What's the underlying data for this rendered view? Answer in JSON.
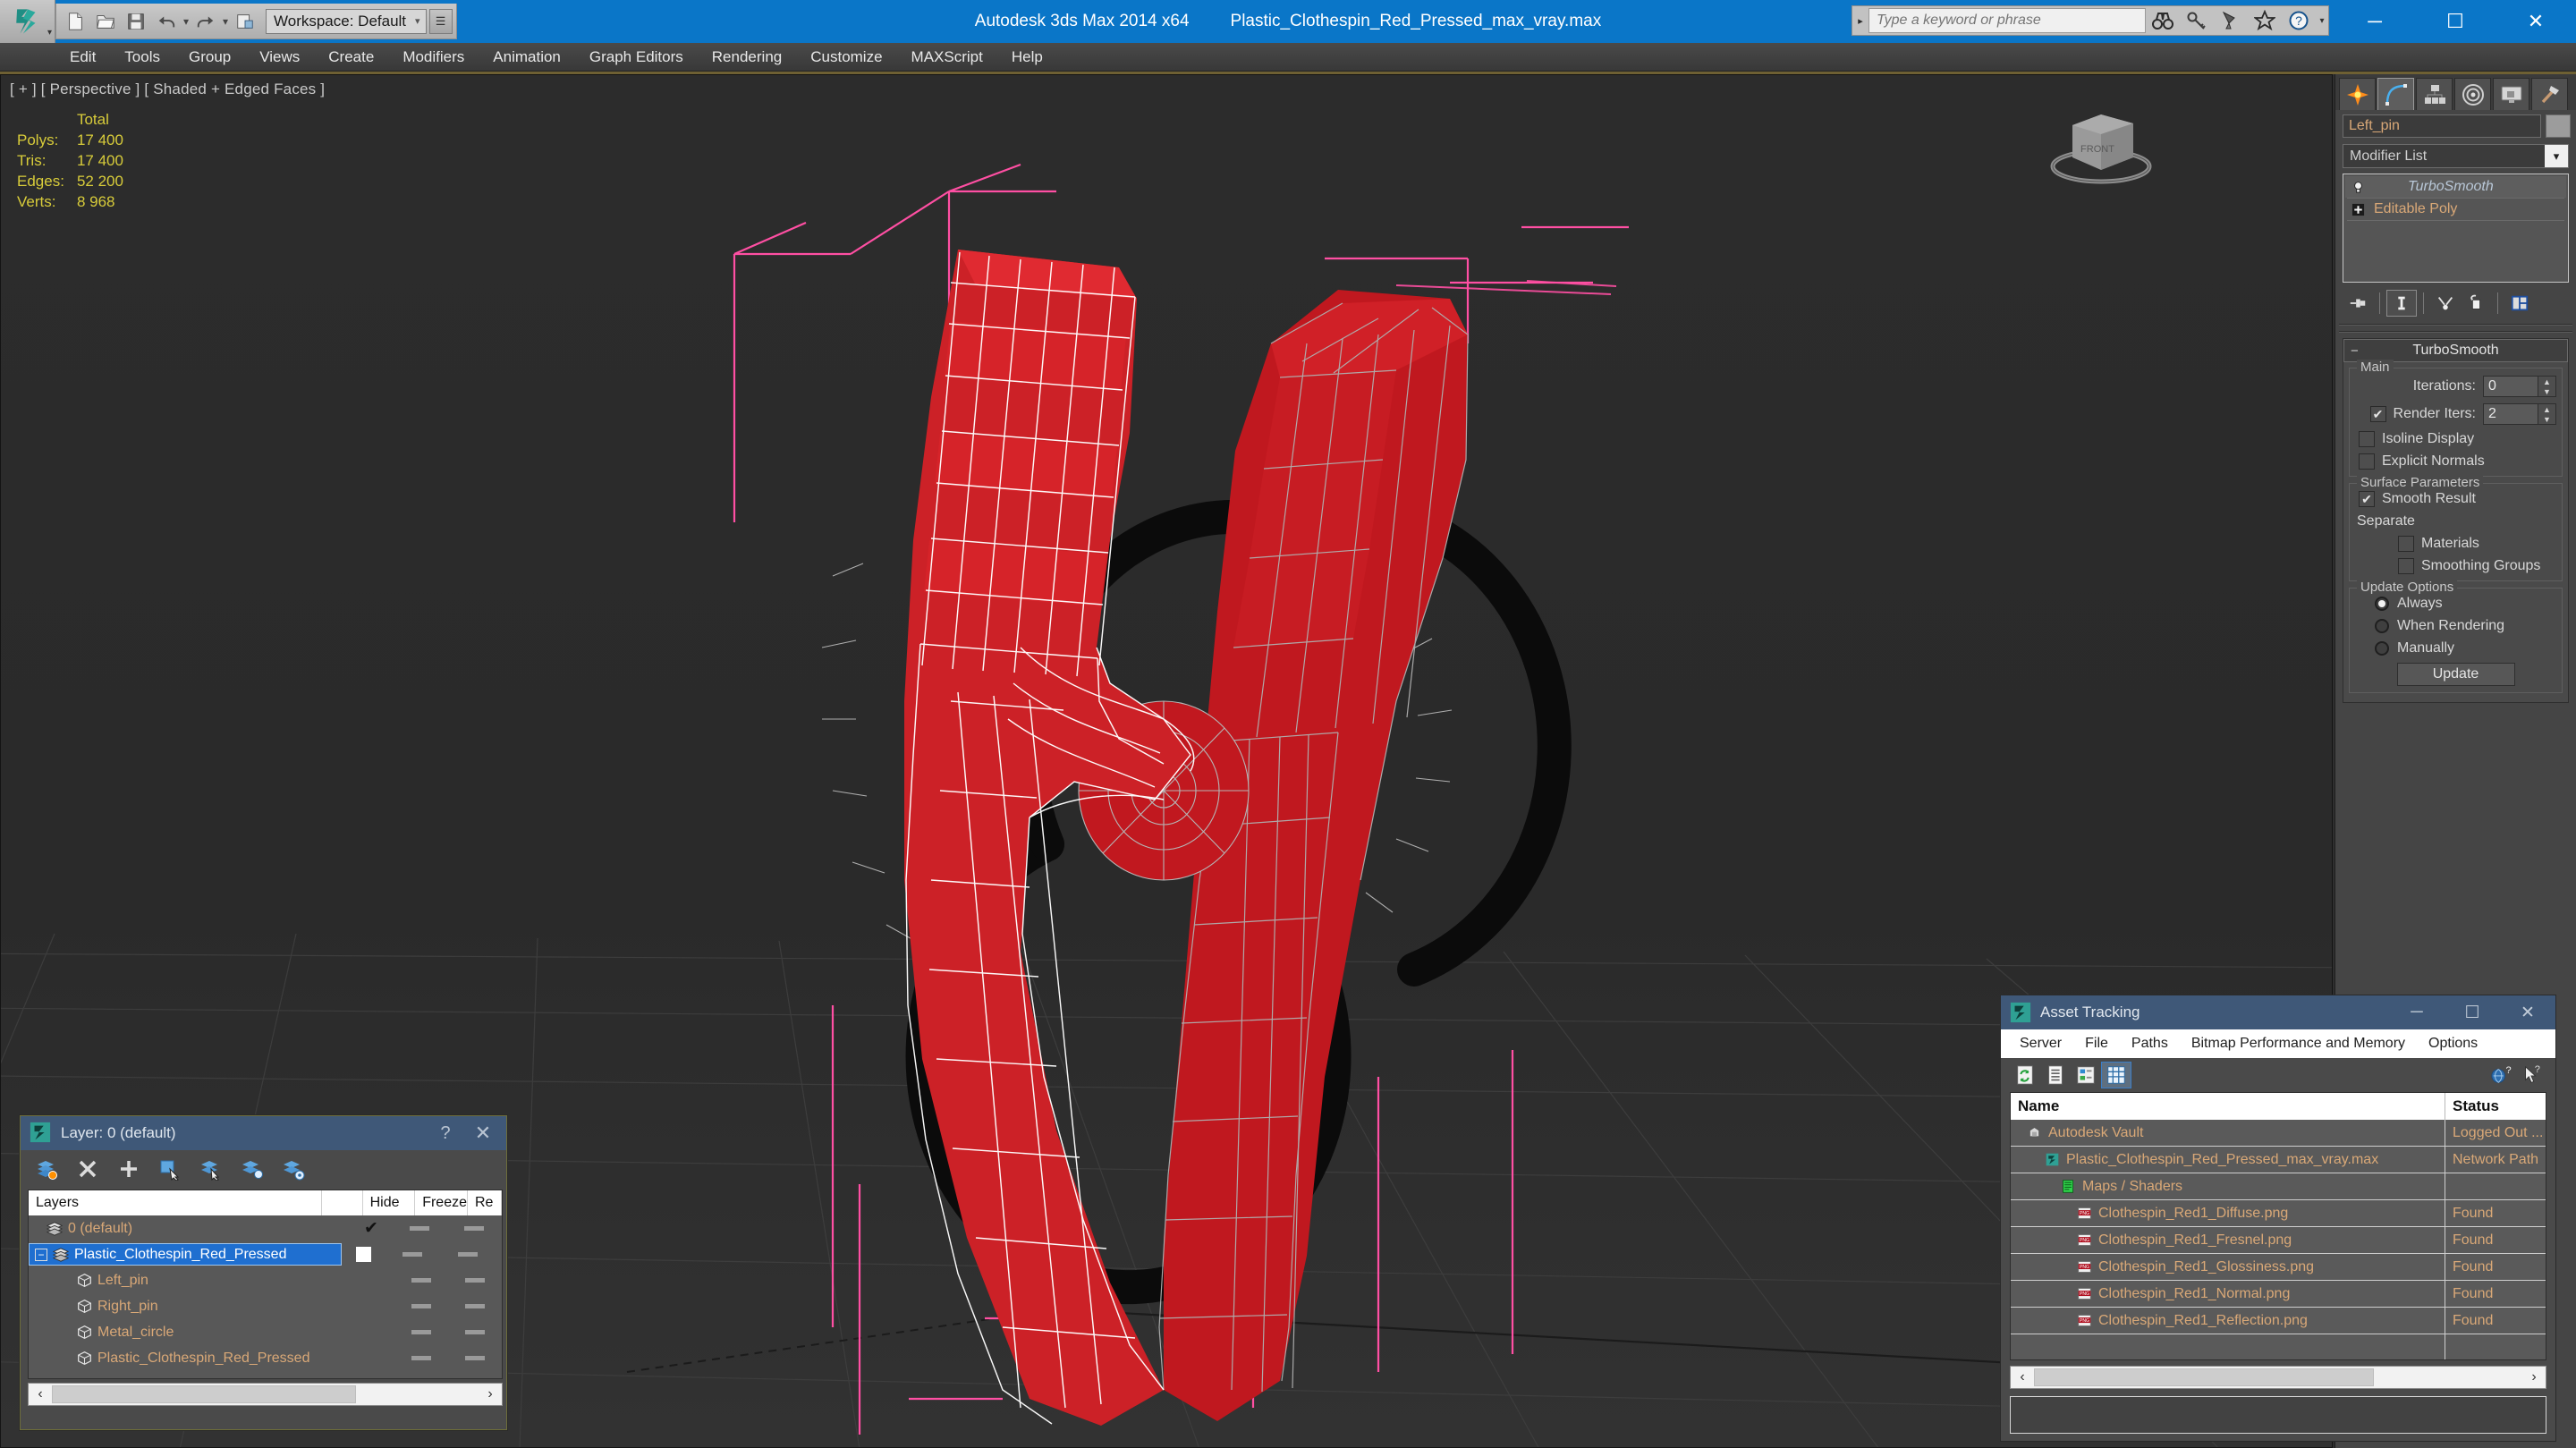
{
  "titlebar": {
    "workspace_label": "Workspace: Default",
    "app_title": "Autodesk 3ds Max  2014 x64",
    "file_title": "Plastic_Clothespin_Red_Pressed_max_vray.max",
    "search_placeholder": "Type a keyword or phrase",
    "minimize": "─",
    "maximize": "☐",
    "close": "✕",
    "quick_access": [
      "new-icon",
      "open-icon",
      "save-icon",
      "undo-icon",
      "redo-icon",
      "set-project-icon"
    ],
    "search_icons": [
      "binoculars-icon",
      "key-icon",
      "satellite-icon",
      "star-icon",
      "help-icon"
    ]
  },
  "menu": {
    "items": [
      "Edit",
      "Tools",
      "Group",
      "Views",
      "Create",
      "Modifiers",
      "Animation",
      "Graph Editors",
      "Rendering",
      "Customize",
      "MAXScript",
      "Help"
    ]
  },
  "viewport": {
    "label": "[ + ] [ Perspective ] [ Shaded + Edged Faces ]",
    "stats": {
      "header": "Total",
      "rows": [
        {
          "label": "Polys:",
          "value": "17 400"
        },
        {
          "label": "Tris:",
          "value": "17 400"
        },
        {
          "label": "Edges:",
          "value": "52 200"
        },
        {
          "label": "Verts:",
          "value": "8 968"
        }
      ]
    },
    "viewcube_face": "FRONT",
    "bg_color": "#2b2b2b",
    "model_color": "#cc2127",
    "selected_wire_color": "#ffffff",
    "unselected_wire_color": "#b4b4b4",
    "gizmo_color": "#ff49a0"
  },
  "command_panel": {
    "tabs": [
      "create-tab-icon",
      "modify-tab-icon",
      "hierarchy-tab-icon",
      "motion-tab-icon",
      "display-tab-icon",
      "utilities-tab-icon"
    ],
    "active_tab_index": 1,
    "object_name": "Left_pin",
    "modifier_list_label": "Modifier List",
    "stack": [
      {
        "name": "TurboSmooth",
        "italic": true,
        "selected": true,
        "icon": "light-bulb-icon"
      },
      {
        "name": "Editable Poly",
        "italic": false,
        "selected": false,
        "icon": "plus-box-icon"
      }
    ],
    "stack_tools": [
      "pin-stack-icon",
      "show-end-result-icon",
      "make-unique-icon",
      "remove-modifier-icon",
      "configure-modifier-sets-icon"
    ],
    "rollout": {
      "title": "TurboSmooth",
      "groups": [
        {
          "label": "Main",
          "iterations_label": "Iterations:",
          "iterations_value": "0",
          "render_iters_label": "Render Iters:",
          "render_iters_value": "2",
          "render_iters_checked": true,
          "isoline_label": "Isoline Display",
          "isoline_checked": false,
          "explicit_label": "Explicit Normals",
          "explicit_checked": false
        },
        {
          "label": "Surface Parameters",
          "smooth_result_label": "Smooth Result",
          "smooth_result_checked": true,
          "separate_label": "Separate",
          "materials_label": "Materials",
          "materials_checked": false,
          "smoothing_groups_label": "Smoothing Groups",
          "smoothing_groups_checked": false
        },
        {
          "label": "Update Options",
          "options": [
            "Always",
            "When Rendering",
            "Manually"
          ],
          "selected_option": 0,
          "update_button": "Update"
        }
      ]
    }
  },
  "layer_dialog": {
    "title": "Layer: 0 (default)",
    "help_glyph": "?",
    "close_glyph": "✕",
    "toolbar": [
      "new-layer-icon",
      "delete-layer-icon",
      "add-selection-icon",
      "select-objects-icon",
      "select-layer-icon",
      "highlight-layer-icon",
      "layer-properties-icon"
    ],
    "columns": [
      "Layers",
      "",
      "Hide",
      "Freeze",
      "Re"
    ],
    "rows": [
      {
        "name": "0 (default)",
        "indent": 0,
        "selected": false,
        "current": true,
        "has_expander": false,
        "hide": "dash",
        "freeze": "dash"
      },
      {
        "name": "Plastic_Clothespin_Red_Pressed",
        "indent": 0,
        "selected": true,
        "current": false,
        "has_expander": true,
        "hide": "dash",
        "freeze": "dash"
      },
      {
        "name": "Left_pin",
        "indent": 1,
        "selected": false,
        "current": false,
        "has_expander": false,
        "hide": "dash",
        "freeze": "dash"
      },
      {
        "name": "Right_pin",
        "indent": 1,
        "selected": false,
        "current": false,
        "has_expander": false,
        "hide": "dash",
        "freeze": "dash"
      },
      {
        "name": "Metal_circle",
        "indent": 1,
        "selected": false,
        "current": false,
        "has_expander": false,
        "hide": "dash",
        "freeze": "dash"
      },
      {
        "name": "Plastic_Clothespin_Red_Pressed",
        "indent": 1,
        "selected": false,
        "current": false,
        "has_expander": false,
        "hide": "dash",
        "freeze": "dash"
      }
    ],
    "scroll_left": "‹",
    "scroll_right": "›"
  },
  "asset_tracking": {
    "title": "Asset Tracking",
    "minimize": "─",
    "maximize": "☐",
    "close": "✕",
    "menu": [
      "Server",
      "File",
      "Paths",
      "Bitmap Performance and Memory",
      "Options"
    ],
    "toolbar": [
      "refresh-icon",
      "list-view-icon",
      "details-view-icon",
      "grid-view-icon"
    ],
    "toolbar_right": [
      "help-globe-icon",
      "help-cursor-icon"
    ],
    "columns": [
      "Name",
      "Status"
    ],
    "rows": [
      {
        "name": "Autodesk Vault",
        "status": "Logged Out ...",
        "indent": 0,
        "icon": "vault-icon"
      },
      {
        "name": "Plastic_Clothespin_Red_Pressed_max_vray.max",
        "status": "Network Path",
        "indent": 1,
        "icon": "max-file-icon"
      },
      {
        "name": "Maps / Shaders",
        "status": "",
        "indent": 2,
        "icon": "maps-shaders-icon"
      },
      {
        "name": "Clothespin_Red1_Diffuse.png",
        "status": "Found",
        "indent": 3,
        "icon": "png-icon"
      },
      {
        "name": "Clothespin_Red1_Fresnel.png",
        "status": "Found",
        "indent": 3,
        "icon": "png-icon"
      },
      {
        "name": "Clothespin_Red1_Glossiness.png",
        "status": "Found",
        "indent": 3,
        "icon": "png-icon"
      },
      {
        "name": "Clothespin_Red1_Normal.png",
        "status": "Found",
        "indent": 3,
        "icon": "png-icon"
      },
      {
        "name": "Clothespin_Red1_Reflection.png",
        "status": "Found",
        "indent": 3,
        "icon": "png-icon"
      }
    ],
    "scroll_left": "‹",
    "scroll_right": "›",
    "status_text": ""
  }
}
